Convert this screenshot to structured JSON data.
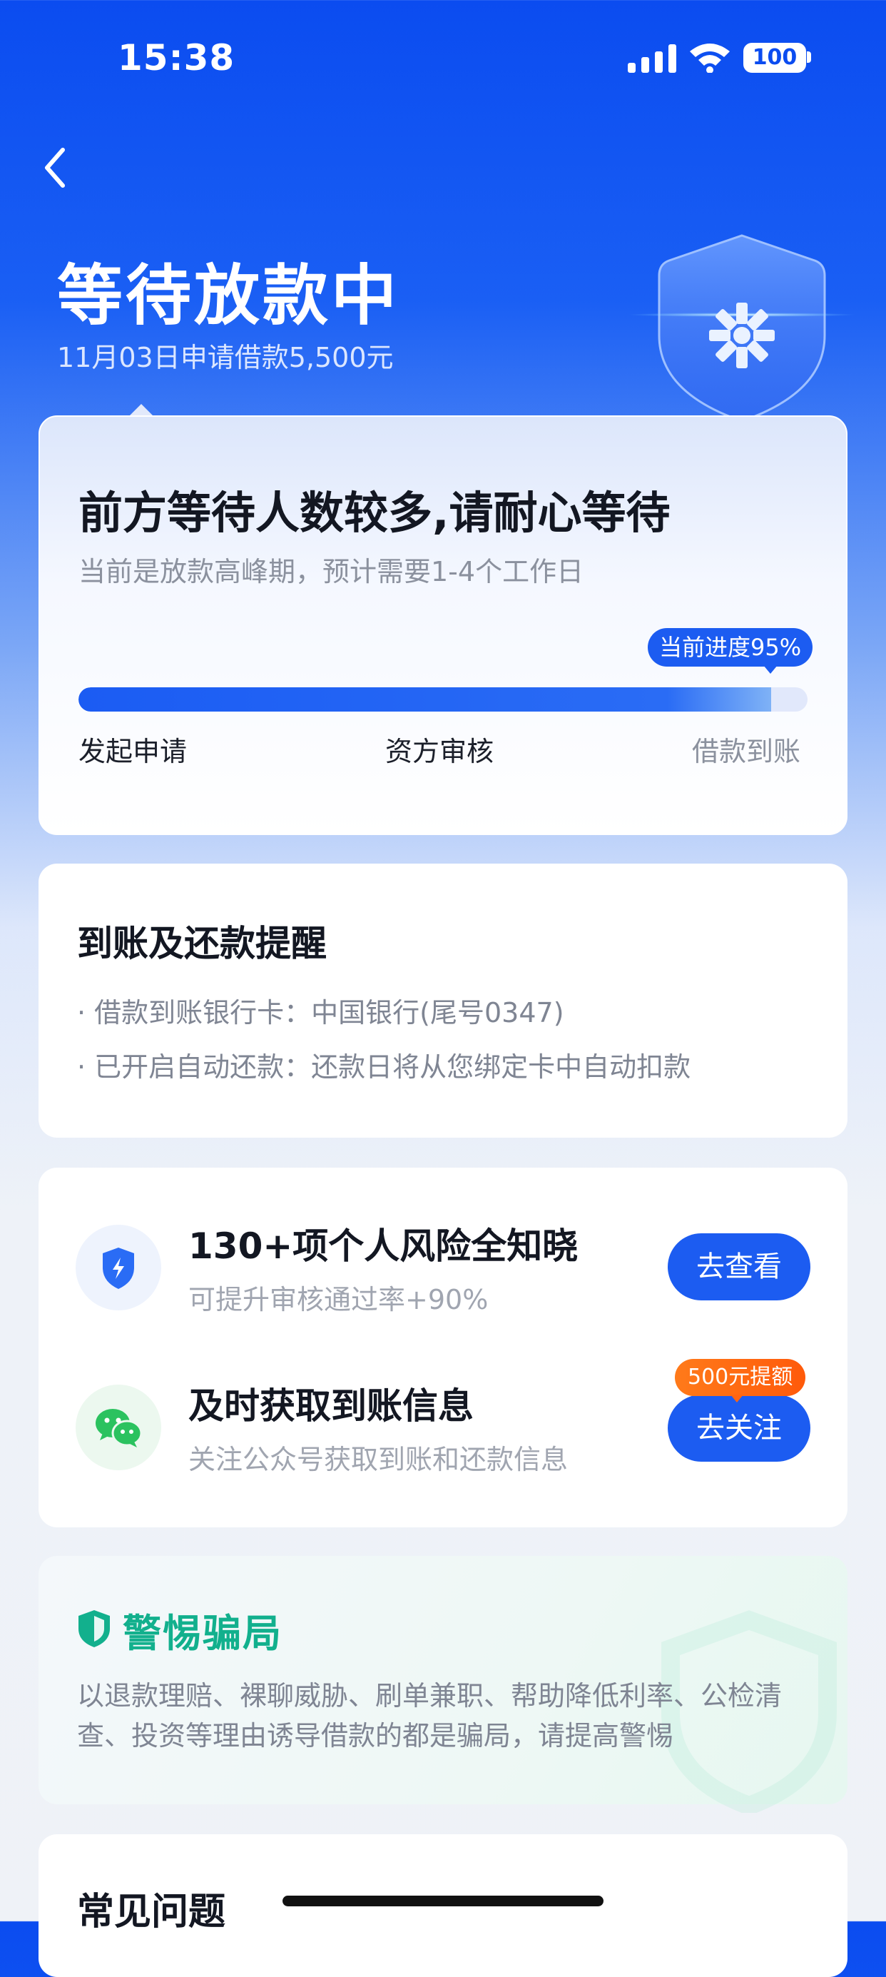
{
  "status_bar": {
    "time": "15:38",
    "battery": "100"
  },
  "header": {
    "title": "等待放款中",
    "subtitle": "11月03日申请借款5,500元"
  },
  "progress_card": {
    "title": "前方等待人数较多,请耐心等待",
    "subtitle": "当前是放款高峰期，预计需要1-4个工作日",
    "progress_label": "当前进度95%",
    "progress_value": 0.95,
    "steps": [
      "发起申请",
      "资方审核",
      "借款到账"
    ]
  },
  "reminder_card": {
    "title": "到账及还款提醒",
    "lines": [
      "借款到账银行卡：中国银行(尾号0347)",
      "已开启自动还款：还款日将从您绑定卡中自动扣款"
    ]
  },
  "service_card": {
    "rows": [
      {
        "icon": "lightning-shield-icon",
        "title": "130+项个人风险全知晓",
        "subtitle": "可提升审核通过率+90%",
        "button": "去查看"
      },
      {
        "icon": "wechat-icon",
        "title": "及时获取到账信息",
        "subtitle": "关注公众号获取到账和还款信息",
        "button": "去关注",
        "tag": "500元提额"
      }
    ]
  },
  "fraud_card": {
    "title": "警惕骗局",
    "text": "以退款理赔、裸聊威胁、刷单兼职、帮助降低利率、公检清查、投资等理由诱导借款的都是骗局，请提高警惕"
  },
  "faq_card": {
    "title": "常见问题"
  },
  "colors": {
    "primary": "#1c5cf1",
    "green": "#12b08d",
    "orange": "#ff6a10"
  }
}
